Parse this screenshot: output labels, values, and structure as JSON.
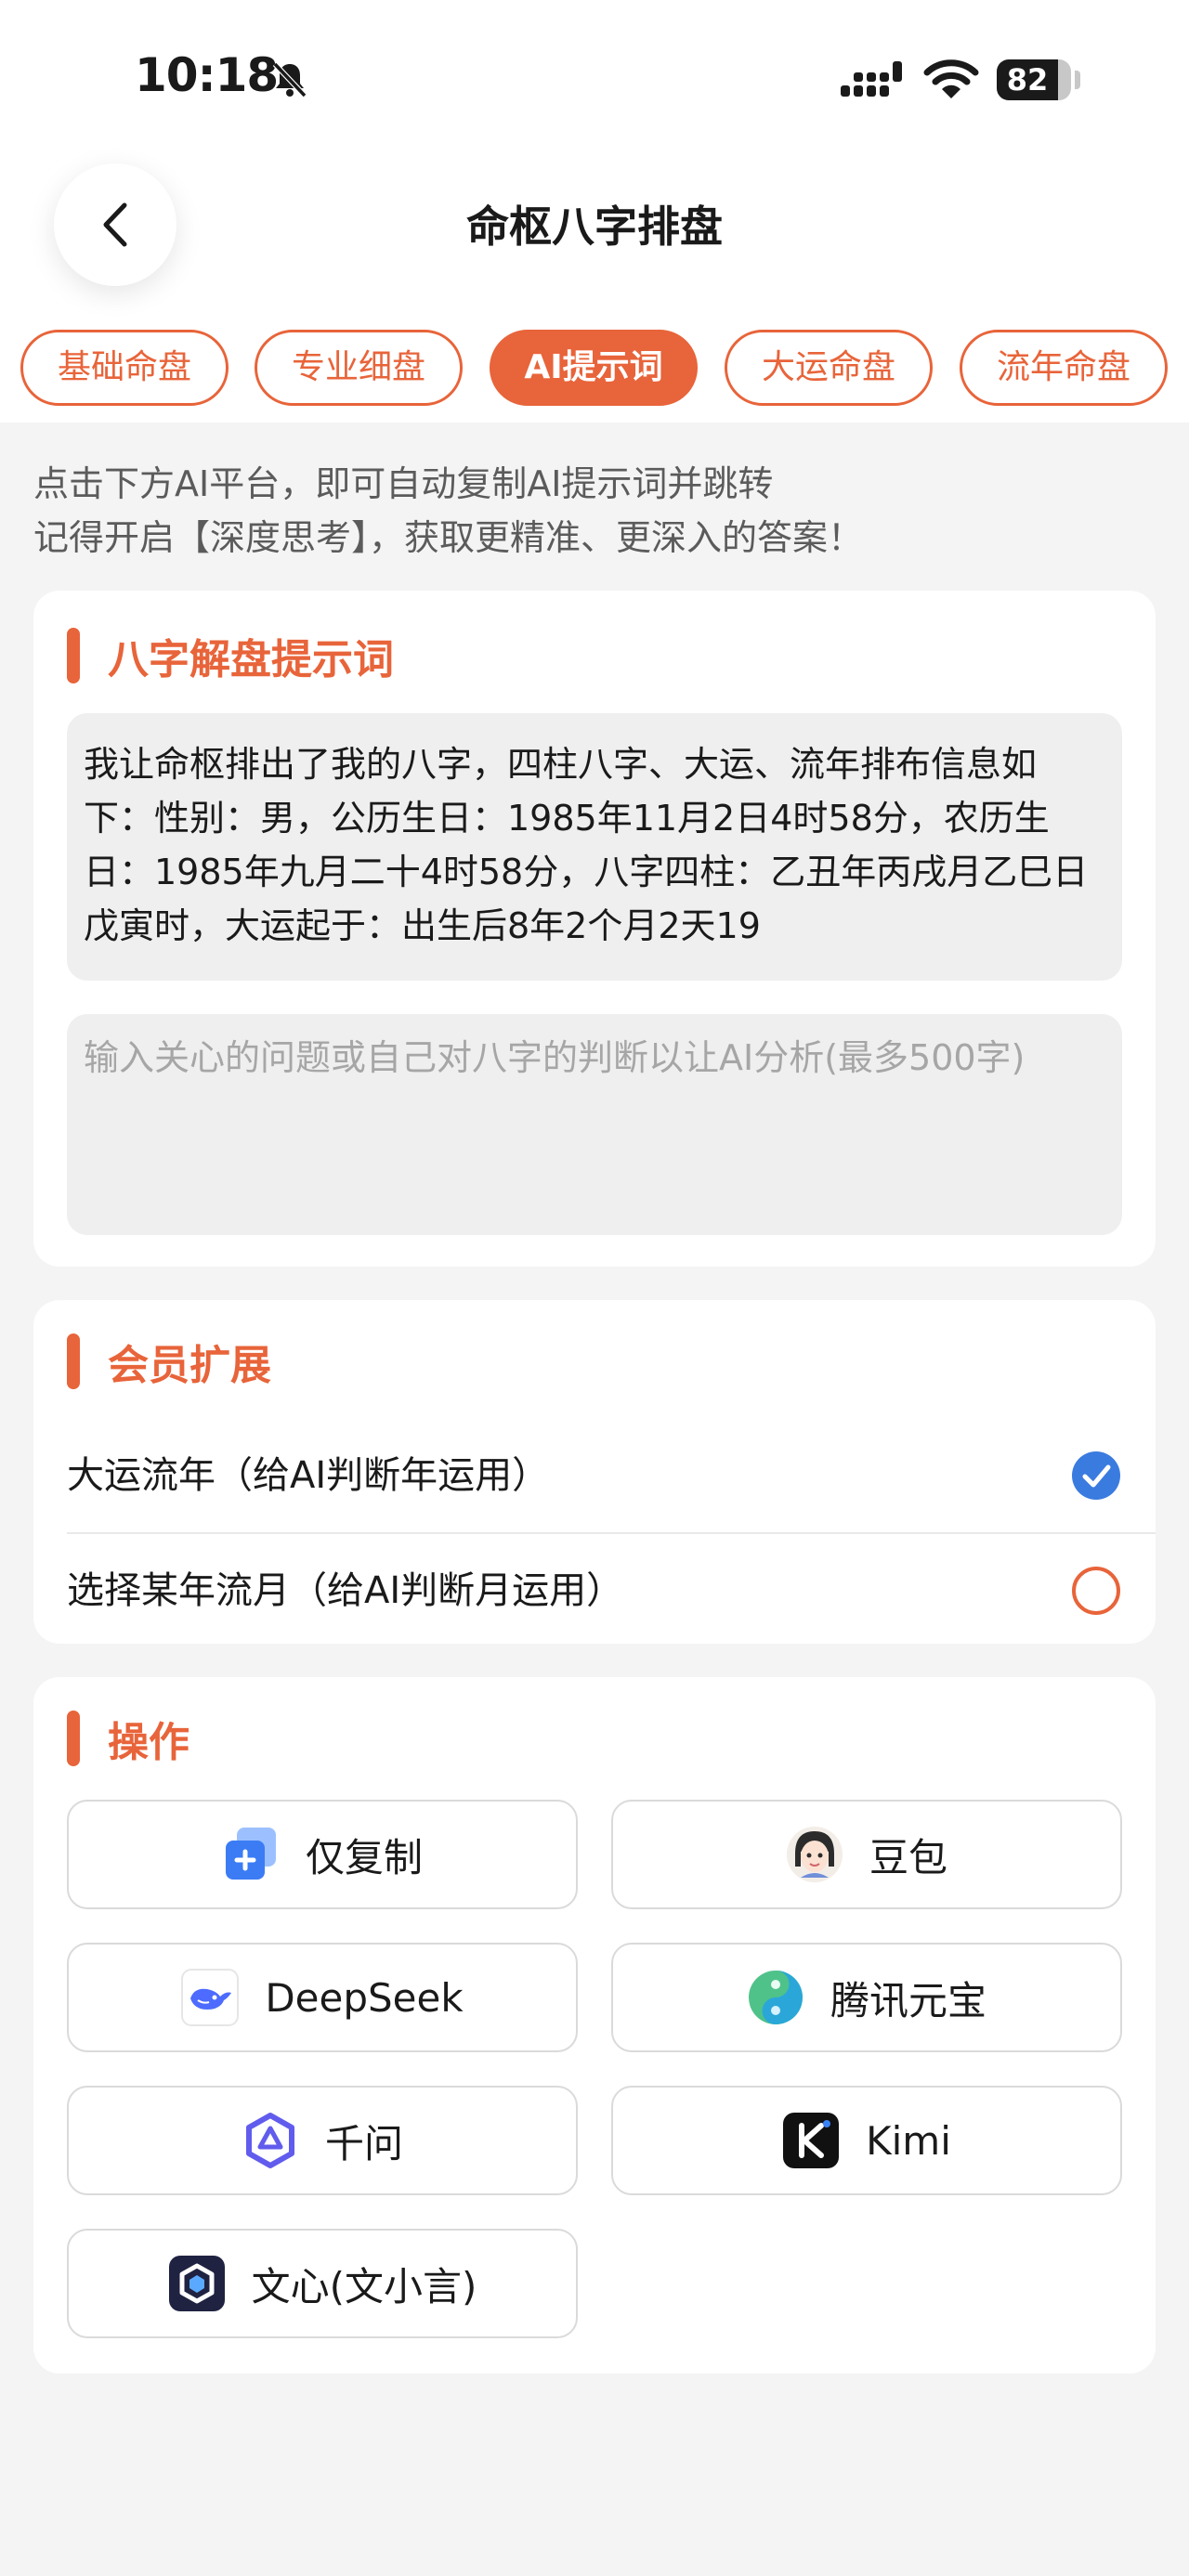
{
  "status_bar": {
    "time": "10:18",
    "battery": "82",
    "battery_level": 0.82
  },
  "header": {
    "title": "命枢八字排盘"
  },
  "tabs": [
    {
      "label": "基础命盘",
      "active": false
    },
    {
      "label": "专业细盘",
      "active": false
    },
    {
      "label": "AI提示词",
      "active": true
    },
    {
      "label": "大运命盘",
      "active": false
    },
    {
      "label": "流年命盘",
      "active": false
    }
  ],
  "hint": {
    "line1": "点击下方AI平台，即可自动复制AI提示词并跳转",
    "line2": "记得开启【深度思考】，获取更精准、更深入的答案！"
  },
  "prompt_section": {
    "title": "八字解盘提示词",
    "prompt_text": "我让命枢排出了我的八字，四柱八字、大运、流年排布信息如下：性别：男，公历生日：1985年11月2日4时58分，农历生日：1985年九月二十4时58分，八字四柱：乙丑年丙戌月乙巳日戊寅时，大运起于：出生后8年2个月2天19",
    "input_placeholder": "输入关心的问题或自己对八字的判断以让AI分析(最多500字)",
    "input_value": ""
  },
  "member_section": {
    "title": "会员扩展",
    "options": [
      {
        "label": "大运流年（给AI判断年运用）",
        "checked": true
      },
      {
        "label": "选择某年流月（给AI判断月运用）",
        "checked": false
      }
    ]
  },
  "actions_section": {
    "title": "操作",
    "buttons": [
      {
        "label": "仅复制",
        "icon": "copy-icon"
      },
      {
        "label": "豆包",
        "icon": "doubao-avatar-icon"
      },
      {
        "label": "DeepSeek",
        "icon": "deepseek-whale-icon"
      },
      {
        "label": "腾讯元宝",
        "icon": "yuanbao-icon"
      },
      {
        "label": "千问",
        "icon": "qianwen-icon"
      },
      {
        "label": "Kimi",
        "icon": "kimi-icon"
      },
      {
        "label": "文心(文小言)",
        "icon": "wenxin-icon"
      }
    ]
  },
  "colors": {
    "accent": "#e8643a",
    "check_blue": "#3a7be0",
    "background": "#f4f4f4",
    "card": "#ffffff"
  }
}
